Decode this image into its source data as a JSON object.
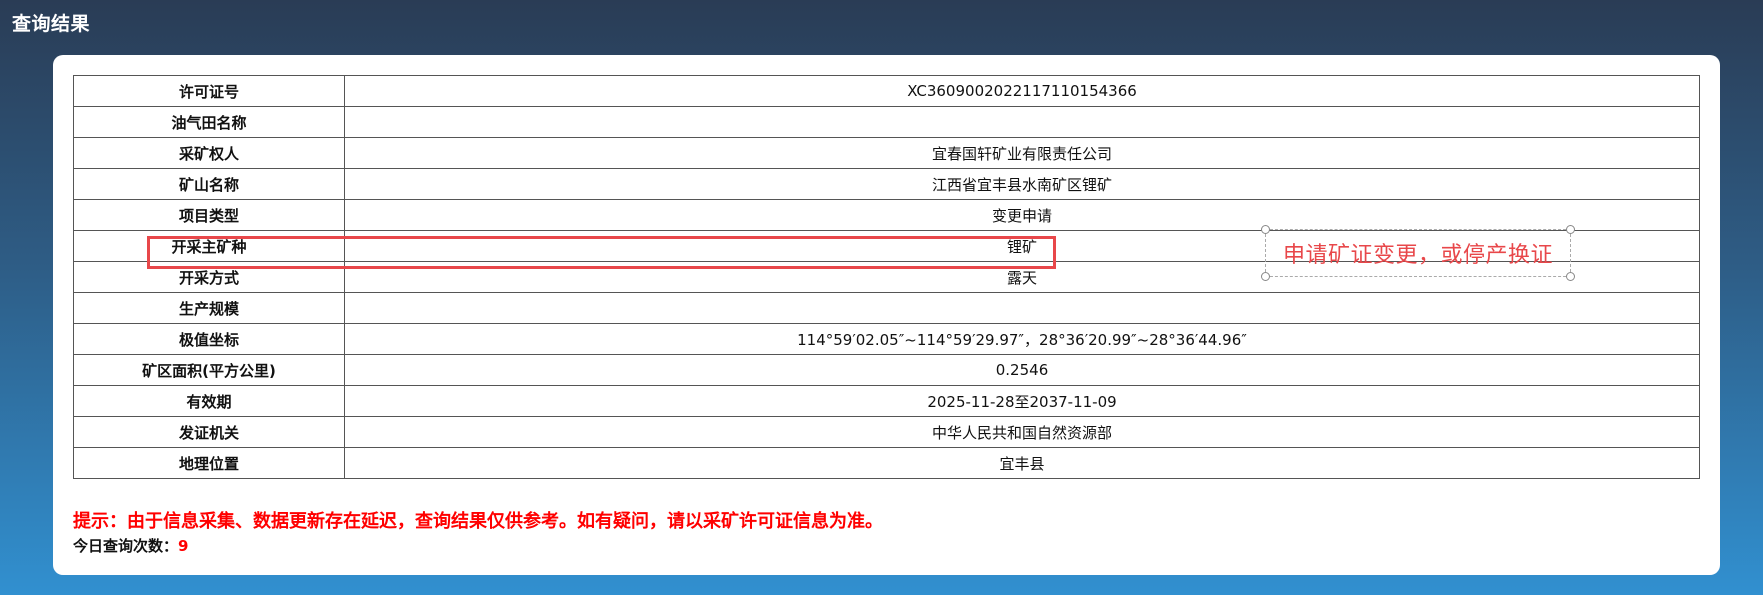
{
  "page": {
    "title": "查询结果"
  },
  "table": {
    "rows": [
      {
        "label": "许可证号",
        "value": "XC3609002022117110154366"
      },
      {
        "label": "油气田名称",
        "value": ""
      },
      {
        "label": "采矿权人",
        "value": "宜春国轩矿业有限责任公司"
      },
      {
        "label": "矿山名称",
        "value": "江西省宜丰县水南矿区锂矿"
      },
      {
        "label": "项目类型",
        "value": "变更申请"
      },
      {
        "label": "开采主矿种",
        "value": "锂矿"
      },
      {
        "label": "开采方式",
        "value": "露天"
      },
      {
        "label": "生产规模",
        "value": ""
      },
      {
        "label": "极值坐标",
        "value": "114°59′02.05″~114°59′29.97″，28°36′20.99″~28°36′44.96″"
      },
      {
        "label": "矿区面积(平方公里)",
        "value": "0.2546"
      },
      {
        "label": "有效期",
        "value": "2025-11-28至2037-11-09"
      },
      {
        "label": "发证机关",
        "value": "中华人民共和国自然资源部"
      },
      {
        "label": "地理位置",
        "value": "宜丰县"
      }
    ]
  },
  "annotation": {
    "text": "申请矿证变更，或停产换证",
    "color": "#e8474a"
  },
  "notice": {
    "warning": "提示：由于信息采集、数据更新存在延迟，查询结果仅供参考。如有疑问，请以采矿许可证信息为准。",
    "count_label": "今日查询次数：",
    "count_value": "9"
  }
}
